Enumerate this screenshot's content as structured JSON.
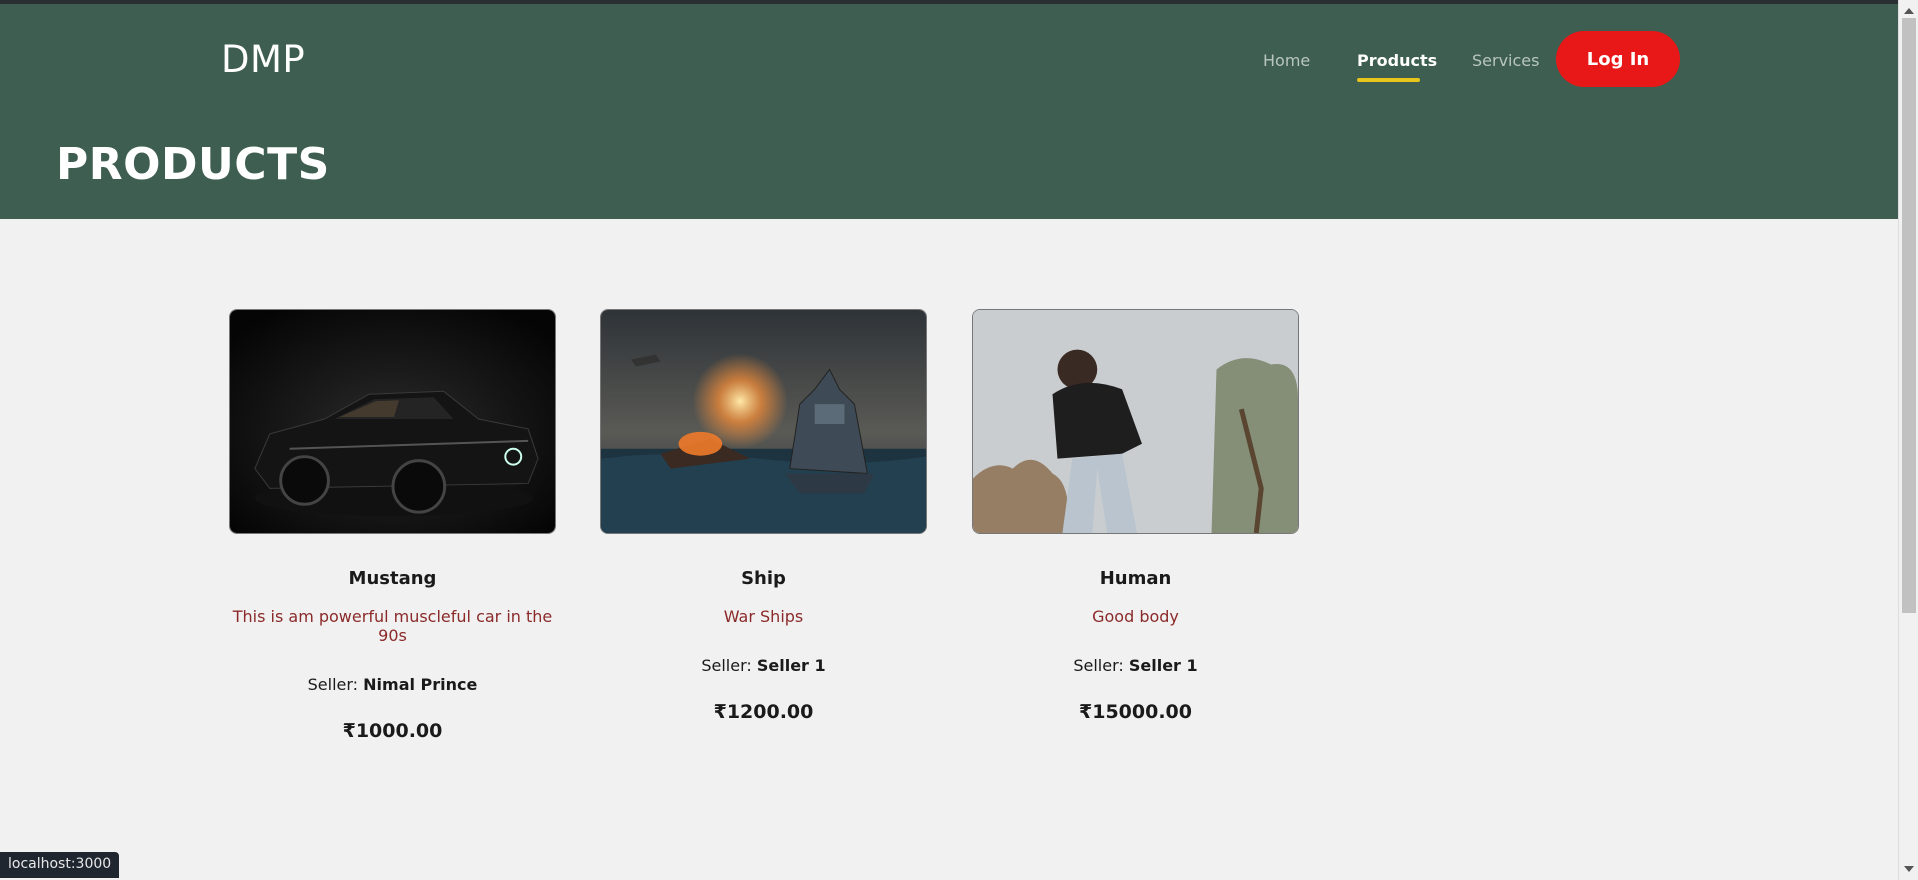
{
  "app": {
    "logo": "DMP",
    "nav": {
      "home": "Home",
      "products": "Products",
      "services": "Services",
      "login": "Log In"
    },
    "page_title": "PRODUCTS"
  },
  "products": [
    {
      "name": "Mustang",
      "description": "This is am powerful muscleful car in the 90s",
      "seller_label": "Seller:",
      "seller": "Nimal Prince",
      "price": "₹1000.00"
    },
    {
      "name": "Ship",
      "description": "War Ships",
      "seller_label": "Seller:",
      "seller": "Seller 1",
      "price": "₹1200.00"
    },
    {
      "name": "Human",
      "description": "Good body",
      "seller_label": "Seller:",
      "seller": "Seller 1",
      "price": "₹15000.00"
    }
  ],
  "status_bar": {
    "url": "localhost:3000"
  },
  "colors": {
    "header": "#3d5e50",
    "login": "#e81818",
    "active_underline": "#e8c51a",
    "description": "#8b2a2a"
  }
}
